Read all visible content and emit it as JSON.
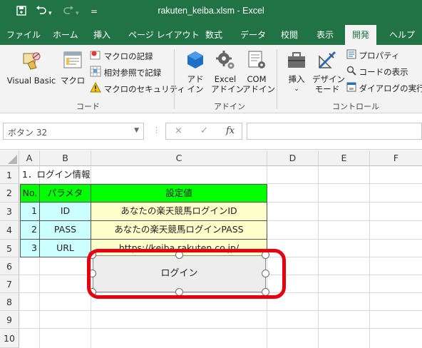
{
  "titlebar": {
    "title": "rakuten_keiba.xlsm  -  Excel",
    "qat_more": "="
  },
  "tabs": [
    "ファイル",
    "ホーム",
    "挿入",
    "ページ レイアウト",
    "数式",
    "データ",
    "校閲",
    "表示",
    "開発",
    "ヘルプ"
  ],
  "ribbon": {
    "code": {
      "visual_basic": "Visual Basic",
      "macro": "マクロ",
      "record_macro": "マクロの記録",
      "relative_ref": "相対参照で記録",
      "macro_security": "マクロのセキュリティ",
      "label": "コード"
    },
    "addin": {
      "addin": [
        "アド",
        "イン"
      ],
      "excel_addin": [
        "Excel",
        "アドイン"
      ],
      "com_addin": [
        "COM",
        "アドイン"
      ],
      "label": "アドイン"
    },
    "controls": {
      "insert": "挿入",
      "design_mode": [
        "デザイン",
        "モード"
      ],
      "properties": "プロパティ",
      "view_code": "コードの表示",
      "run_dialog": "ダイアログの実行",
      "label": "コントロール"
    }
  },
  "formula_bar": {
    "name_box": "ボタン 32",
    "cancel": "×",
    "enter": "✓",
    "fx": "fx",
    "value": ""
  },
  "grid": {
    "columns": [
      "A",
      "B",
      "C",
      "D",
      "E",
      "F"
    ],
    "rows": [
      "1",
      "2",
      "3",
      "4",
      "5",
      "6",
      "7",
      "8",
      "9",
      "10"
    ],
    "cells": {
      "A1": "1．ログイン情報",
      "A2": "No.",
      "B2": "パラメタ",
      "C2": "設定値",
      "A3": "1",
      "B3": "ID",
      "C3": "あなたの楽天競馬ログインID",
      "A4": "2",
      "B4": "PASS",
      "C4": "あなたの楽天競馬ログインPASS",
      "A5": "3",
      "B5": "URL",
      "C5": "https://keiba.rakuten.co.jp/"
    }
  },
  "button": {
    "label": "ログイン"
  },
  "colors": {
    "excel_green": "#217346",
    "header_green": "#00ff00",
    "param_cyan": "#ccffff",
    "value_yellow": "#ffffcc",
    "highlight_red": "#e8000f"
  }
}
